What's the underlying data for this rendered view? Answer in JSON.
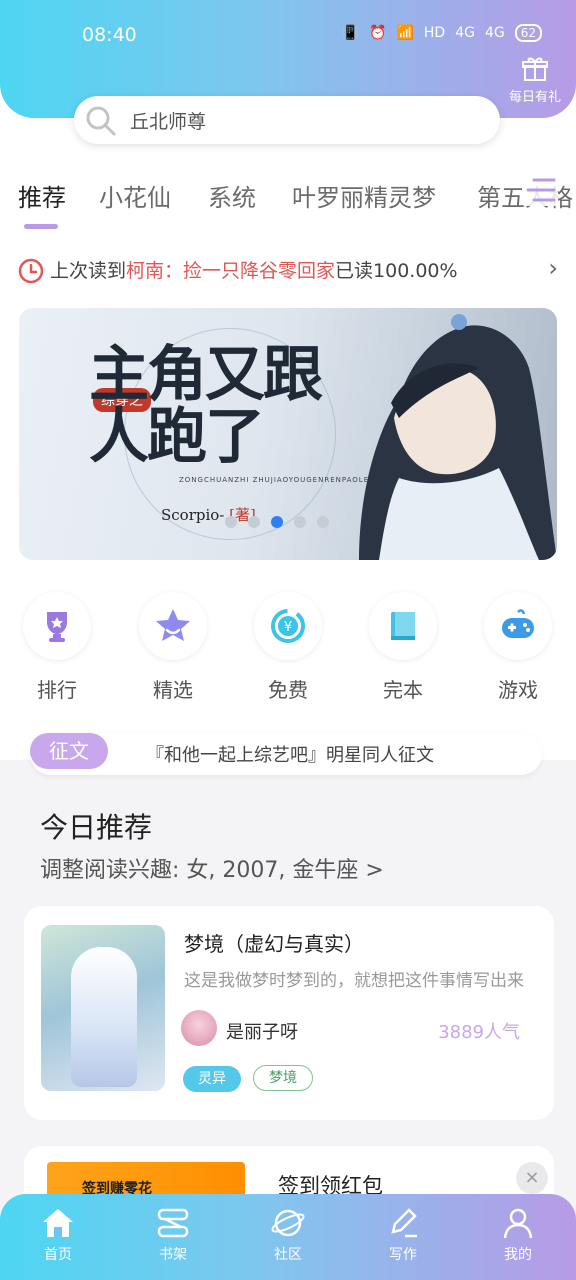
{
  "status": {
    "time": "08:40",
    "net": "HD",
    "sig1": "4G",
    "sig2": "4G",
    "battery": "62"
  },
  "header": {
    "gift_label": "每日有礼",
    "search_text": "丘北师尊"
  },
  "tabs": [
    "推荐",
    "小花仙",
    "系统",
    "叶罗丽精灵梦",
    "第五人格"
  ],
  "last_read": {
    "prefix": "上次读到",
    "book": "柯南：捡一只降谷零回家",
    "progress": "已读100.00%"
  },
  "banner": {
    "tag": "综穿之",
    "title": "主角又跟人跑了",
    "pinyin": "ZONGCHUANZHI ZHUJIAOYOUGENRENPAOLE",
    "author": "Scorpio-.",
    "author_mark": "[著]"
  },
  "categories": [
    {
      "label": "排行",
      "icon": "trophy-icon"
    },
    {
      "label": "精选",
      "icon": "star-icon"
    },
    {
      "label": "免费",
      "icon": "yen-icon"
    },
    {
      "label": "完本",
      "icon": "book-icon"
    },
    {
      "label": "游戏",
      "icon": "gamepad-icon"
    }
  ],
  "notice": {
    "tag": "征文",
    "text": "『和他一起上综艺吧』明星同人征文"
  },
  "recommend": {
    "title": "今日推荐",
    "subtitle": "调整阅读兴趣: 女, 2007, 金牛座 >"
  },
  "book": {
    "title": "梦境（虚幻与真实）",
    "desc": "这是我做梦时梦到的，就想把这件事情写出来",
    "author": "是丽子呀",
    "popularity": "3889人气",
    "tags": [
      "灵异",
      "梦境"
    ]
  },
  "ad": {
    "image_text": "签到赚零花",
    "title": "签到领红包"
  },
  "nav": [
    "首页",
    "书架",
    "社区",
    "写作",
    "我的"
  ],
  "colors": {
    "accent": "#b79be6",
    "cyan": "#4dd6f2",
    "red": "#e25656"
  }
}
